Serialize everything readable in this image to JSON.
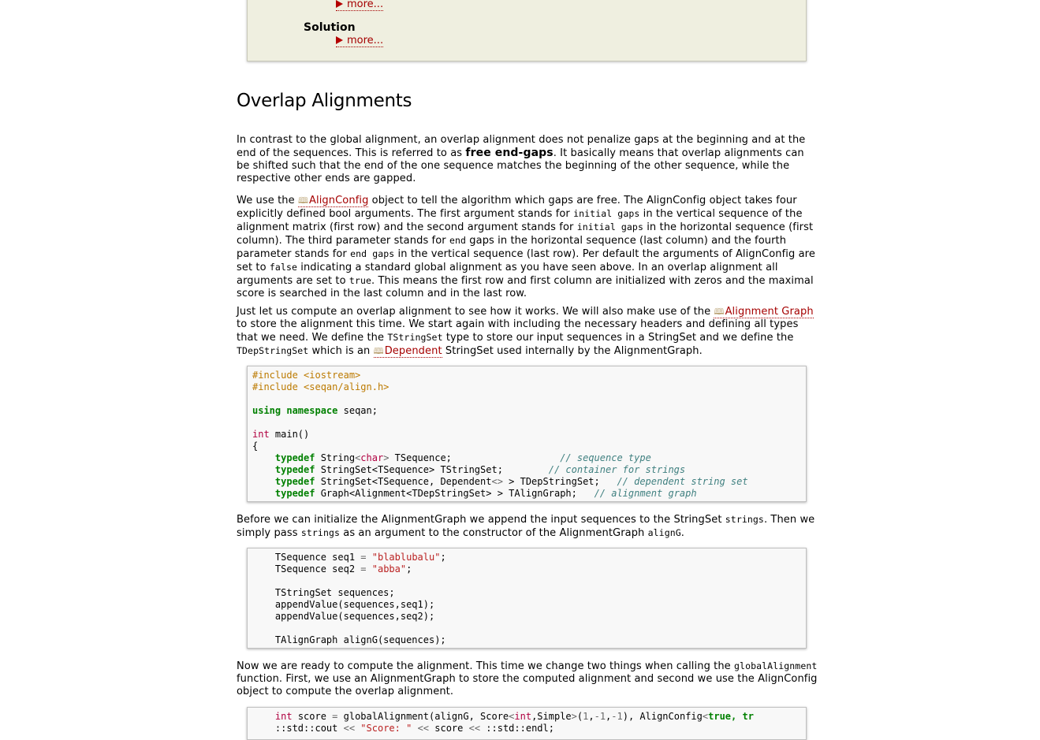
{
  "top_box": {
    "more_label": "more...",
    "solution_label": "Solution"
  },
  "section": {
    "title": "Overlap Alignments"
  },
  "p1": {
    "t1": "In contrast to the global alignment, an overlap alignment does not penalize gaps at the beginning and at the end of the sequences. This is referred to as ",
    "bold": "free end-gaps",
    "t2": ". It basically means that overlap alignments can be shifted such that the end of the one sequence matches the beginning of the other sequence, while the respective other ends are gapped."
  },
  "p2": {
    "t1": "We use the ",
    "link": "AlignConfig",
    "t2": " object to tell the algorithm which gaps are free. The AlignConfig object takes four explicitly defined bool arguments. The first argument stands for ",
    "c1": "initial gaps",
    "t3": " in the vertical sequence of the alignment matrix (first row) and the second argument stands for ",
    "c2": "initial gaps",
    "t4": " in the horizontal sequence (first column). The third parameter stands for ",
    "c3": "end",
    "t5": " gaps in the horizontal sequence (last column) and the fourth parameter stands for ",
    "c4": "end gaps",
    "t6": " in the vertical sequence (last row). Per default the arguments of AlignConfig are set to ",
    "c5": "false",
    "t7": " indicating a standard global alignment as you have seen above. In an overlap alignment all arguments are set to ",
    "c6": "true",
    "t8": ". This means the first row and first column are initialized with zeros and the maximal score is searched in the last column and in the last row."
  },
  "p3": {
    "t1": "Just let us compute an overlap alignment to see how it works. We will also make use of the ",
    "link1": "Alignment Graph",
    "t2": " to store the alignment this time. We start again with including the necessary headers and defining all types that we need. We define the ",
    "c1": "TStringSet",
    "t3": " type to store our input sequences in a StringSet and we define the ",
    "c2": "TDepStringSet",
    "t4": " which is an ",
    "link2": "Dependent",
    "t5": " StringSet used internally by the AlignmentGraph."
  },
  "code1": {
    "l1": "#include <iostream>",
    "l2": "#include <seqan/align.h>",
    "l3_kw1": "using",
    "l3_kw2": "namespace",
    "l3_rest": " seqan;",
    "l4_ty": "int",
    "l4_rest": " main()",
    "l5": "{",
    "td": "typedef",
    "l6_a": " String",
    "l6_ty": "char",
    "l6_b": " TSequence;",
    "l6_cm": "// sequence type",
    "l7_a": " StringSet",
    "l7_b": "TSequence",
    "l7_c": " TStringSet;",
    "l7_cm": "// container for strings",
    "l8_a": " StringSet",
    "l8_b": "TSequence, Dependent",
    "l8_c": " TDepStringSet;",
    "l8_cm": "// dependent string set",
    "l9_a": " Graph",
    "l9_b": "Alignment",
    "l9_c": "TDepStringSet",
    "l9_d": " TAlignGraph;",
    "l9_cm": "// alignment graph"
  },
  "p4": {
    "t1": "Before we can initialize the AlignmentGraph we append the input sequences to the StringSet ",
    "c1": "strings",
    "t2": ". Then we simply pass ",
    "c2": "strings",
    "t3": " as an argument to the constructor of the AlignmentGraph ",
    "c3": "alignG",
    "t4": "."
  },
  "code2": {
    "l1_a": "TSequence seq1 ",
    "l1_s": "\"blablubalu\"",
    "l2_a": "TSequence seq2 ",
    "l2_s": "\"abba\"",
    "l3": "TStringSet sequences;",
    "l4": "appendValue(sequences,seq1);",
    "l5": "appendValue(sequences,seq2);",
    "l6": "TAlignGraph alignG(sequences);"
  },
  "p5": {
    "t1": "Now we are ready to compute the alignment. This time we change two things when calling the ",
    "c1": "globalAlignment",
    "t2": " function. First, we use an AlignmentGraph to store the computed alignment and second we use the AlignConfig object to compute the overlap alignment."
  },
  "code3": {
    "l1_ty": "int",
    "l1_a": " score ",
    "l1_b": " globalAlignment(alignG, Score",
    "l1_ty2": "int",
    "l1_c": ",Simple",
    "l1_n1": "1",
    "l1_n2": "-1",
    "l1_n3": "-1",
    "l1_d": " AlignConfig",
    "l1_kw": "true",
    "l1_e": ", tr",
    "l2_a": "::std::cout ",
    "l2_s": "\"Score: \"",
    "l2_b": " score ",
    "l2_c": " ::std::endl;"
  }
}
